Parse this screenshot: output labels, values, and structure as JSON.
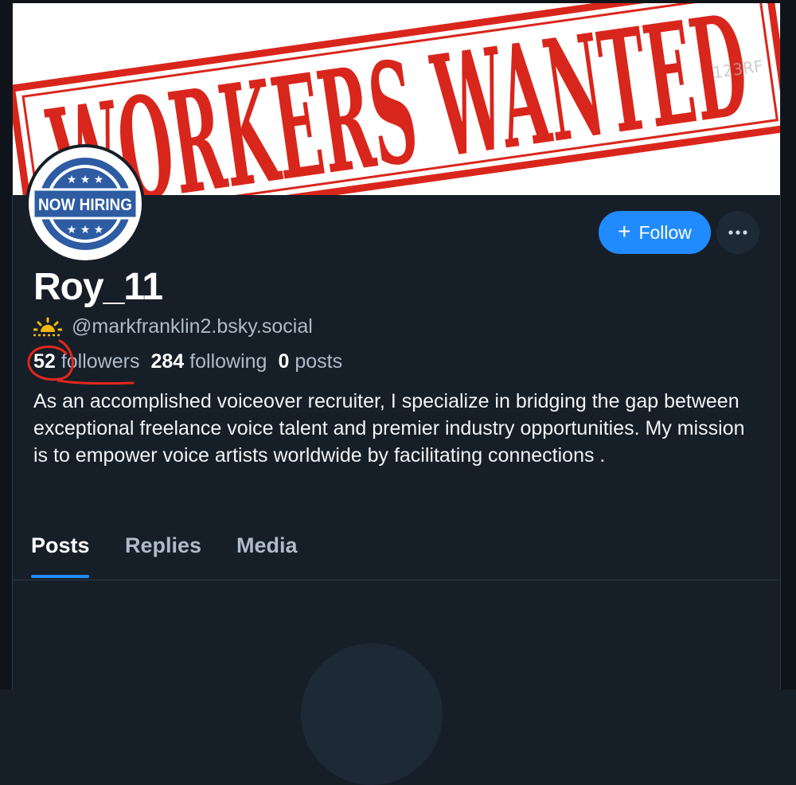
{
  "banner": {
    "headline": "WORKERS WANTED",
    "watermark": "123RF",
    "brand_color": "#d9261c"
  },
  "avatar": {
    "badge_text": "NOW HIRING",
    "badge_color": "#2e5ca3"
  },
  "actions": {
    "follow_label": "Follow",
    "follow_icon": "plus-icon",
    "more_icon": "ellipsis-icon"
  },
  "profile": {
    "display_name": "Roy_11",
    "handle_icon": "sunrise-emoji",
    "handle": "@markfranklin2.bsky.social",
    "stats": {
      "followers_count": "52",
      "followers_label": "followers",
      "following_count": "284",
      "following_label": "following",
      "posts_count": "0",
      "posts_label": "posts"
    },
    "bio": "As an accomplished voiceover recruiter, I specialize in bridging the gap between exceptional freelance voice talent and premier industry opportunities. My mission is to empower voice artists worldwide by facilitating connections ."
  },
  "tabs": [
    {
      "label": "Posts",
      "active": true
    },
    {
      "label": "Replies",
      "active": false
    },
    {
      "label": "Media",
      "active": false
    }
  ],
  "colors": {
    "accent": "#208bfe",
    "background": "#161e27",
    "annotation": "#e0281e"
  }
}
